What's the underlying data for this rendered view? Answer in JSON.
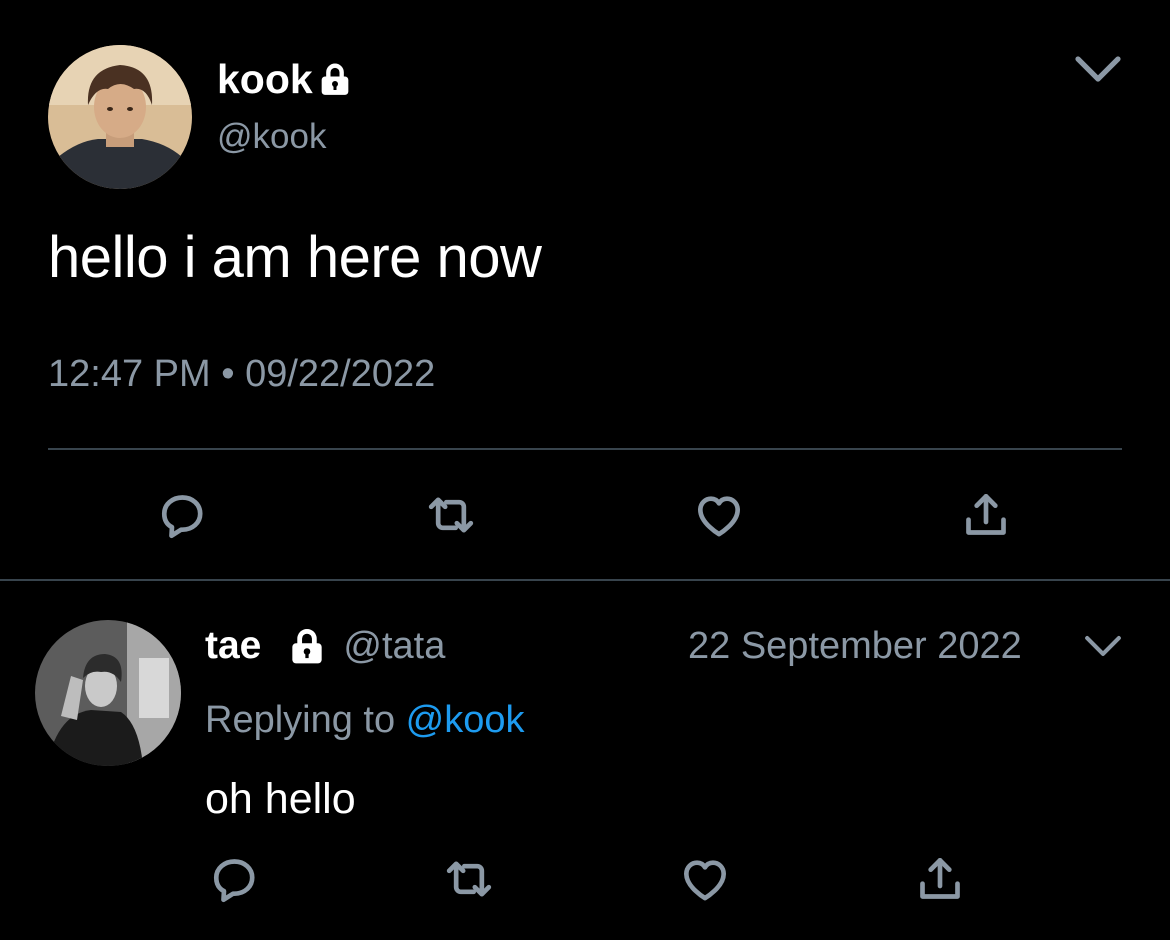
{
  "main_tweet": {
    "display_name": "kook",
    "handle": "@kook",
    "text": "hello i am here now",
    "timestamp": "12:47 PM • 09/22/2022",
    "icons": [
      "lock-icon",
      "chevron-down-icon",
      "reply-icon",
      "retweet-icon",
      "like-icon",
      "share-icon"
    ]
  },
  "reply_tweet": {
    "display_name": "tae",
    "handle": "@tata",
    "date": "22 September 2022",
    "replying_prefix": "Replying to ",
    "replying_mention": "@kook",
    "text": "oh hello",
    "icons": [
      "lock-icon",
      "chevron-down-icon",
      "reply-icon",
      "retweet-icon",
      "like-icon",
      "share-icon"
    ]
  },
  "colors": {
    "background": "#000000",
    "primary_text": "#ffffff",
    "secondary_text": "#8b98a5",
    "mention": "#1d9bf0",
    "divider": "#38444d"
  }
}
